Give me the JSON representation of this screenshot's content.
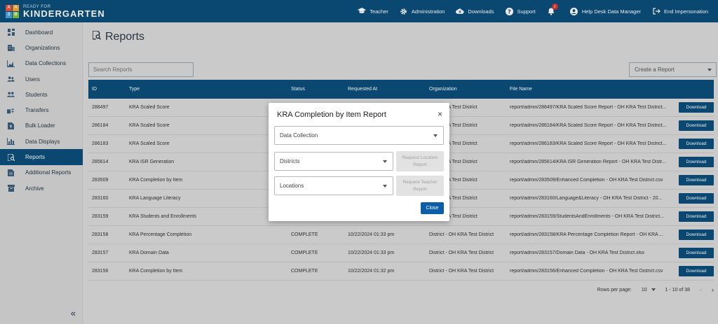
{
  "brand": {
    "small": "READY FOR",
    "big": "KINDERGARTEN"
  },
  "topnav": [
    {
      "label": "Teacher",
      "icon": "graduation-cap-icon"
    },
    {
      "label": "Administration",
      "icon": "gear-icon"
    },
    {
      "label": "Downloads",
      "icon": "cloud-download-icon"
    },
    {
      "label": "Support",
      "icon": "help-icon"
    },
    {
      "label": "",
      "icon": "bell-icon",
      "badge": "2"
    },
    {
      "label": "Help Desk Data Manager",
      "icon": "user-circle-icon"
    },
    {
      "label": "End Impersonation",
      "icon": "logout-icon"
    }
  ],
  "sidebar": {
    "items": [
      {
        "label": "Dashboard",
        "icon": "dashboard-icon"
      },
      {
        "label": "Organizations",
        "icon": "building-icon"
      },
      {
        "label": "Data Collections",
        "icon": "chart-area-icon"
      },
      {
        "label": "Users",
        "icon": "users-icon"
      },
      {
        "label": "Students",
        "icon": "students-icon"
      },
      {
        "label": "Transfers",
        "icon": "transfer-icon"
      },
      {
        "label": "Bulk Loader",
        "icon": "file-upload-icon"
      },
      {
        "label": "Data Displays",
        "icon": "bar-chart-icon"
      },
      {
        "label": "Reports",
        "icon": "report-search-icon",
        "active": true
      },
      {
        "label": "Additional Reports",
        "icon": "document-icon"
      },
      {
        "label": "Archive",
        "icon": "archive-icon"
      }
    ],
    "collapse": "«"
  },
  "page": {
    "title": "Reports",
    "search_placeholder": "Search Reports",
    "create_label": "Create a Report"
  },
  "table": {
    "headers": [
      "ID",
      "Type",
      "Status",
      "Requested At",
      "Organization",
      "File Name"
    ],
    "download_label": "Download",
    "rows": [
      {
        "id": "288497",
        "type": "KRA Scaled Score",
        "status": "",
        "req": "",
        "org": "- OH KRA Test District",
        "file": "report/admin/288497/KRA Scaled Score Report - OH KRA Test District..."
      },
      {
        "id": "286184",
        "type": "KRA Scaled Score",
        "status": "",
        "req": "",
        "org": "- OH KRA Test District",
        "file": "report/admin/286184/KRA Scaled Score Report - OH KRA Test District..."
      },
      {
        "id": "286183",
        "type": "KRA Scaled Score",
        "status": "",
        "req": "",
        "org": "- OH KRA Test District",
        "file": "report/admin/286183/KRA Scaled Score Report - OH KRA Test District..."
      },
      {
        "id": "285614",
        "type": "KRA ISR Generation",
        "status": "",
        "req": "",
        "org": "- OH KRA Test District",
        "file": "report/admin/285614/KRA ISR Generation Report - OH KRA Test Distr..."
      },
      {
        "id": "283509",
        "type": "KRA Completion by Item",
        "status": "",
        "req": "",
        "org": "- OH KRA Test District",
        "file": "report/admin/283509/Enhanced Completion - OH KRA Test District.csv"
      },
      {
        "id": "283160",
        "type": "KRA Language Literacy",
        "status": "",
        "req": "",
        "org": "- OH KRA Test District",
        "file": "report/admin/283160/Language&Literacy - OH KRA Test District - 20..."
      },
      {
        "id": "283159",
        "type": "KRA Students and Enrollments",
        "status": "",
        "req": "",
        "org": "- OH KRA Test District",
        "file": "report/admin/283159/StudentsAndEnrollments - OH KRA Test District..."
      },
      {
        "id": "283158",
        "type": "KRA Percentage Completion",
        "status": "COMPLETE",
        "req": "10/22/2024 01:33 pm",
        "org": "District - OH KRA Test District",
        "file": "report/admin/283158/KRA Percentage Completion Report - OH KRA ..."
      },
      {
        "id": "283157",
        "type": "KRA Domain Data",
        "status": "COMPLETE",
        "req": "10/22/2024 01:33 pm",
        "org": "District - OH KRA Test District",
        "file": "report/admin/283157/Domain Data - OH KRA Test District.xlsx"
      },
      {
        "id": "283156",
        "type": "KRA Completion by Item",
        "status": "COMPLETE",
        "req": "10/22/2024 01:32 pm",
        "org": "District - OH KRA Test District",
        "file": "report/admin/283156/Enhanced Completion - OH KRA Test District.csv"
      }
    ]
  },
  "pager": {
    "rows_label": "Rows per page:",
    "rows_value": "10",
    "range": "1 - 10 of 38",
    "prev": "‹",
    "next": "›"
  },
  "dialog": {
    "title": "KRA Completion by Item Report",
    "close_icon": "×",
    "data_collection": "Data Collection",
    "districts": "Districts",
    "locations": "Locations",
    "req_location": "Request Location Report",
    "req_teacher": "Request Teacher Report",
    "close_label": "Close"
  },
  "colors": {
    "primary": "#0b4f7c",
    "button": "#0b5ea8",
    "badge": "#d93030"
  }
}
